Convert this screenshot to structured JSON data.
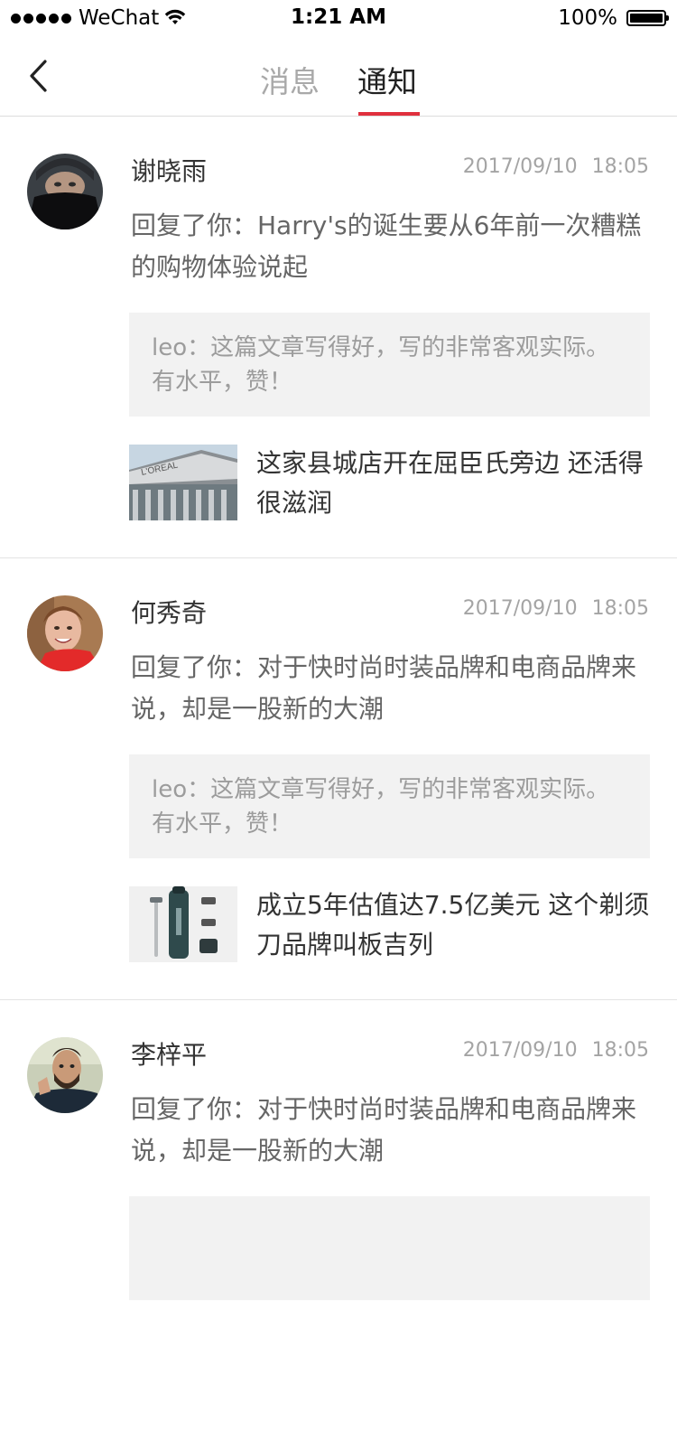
{
  "status_bar": {
    "carrier": "WeChat",
    "time": "1:21 AM",
    "battery": "100%"
  },
  "nav": {
    "tabs": [
      {
        "label": "消息",
        "active": false
      },
      {
        "label": "通知",
        "active": true
      }
    ],
    "accent_color": "#e0303e"
  },
  "notifications": [
    {
      "name": "谢晓雨",
      "date": "2017/09/10",
      "time": "18:05",
      "reply": "回复了你：Harry's的诞生要从6年前一次糟糕的购物体验说起",
      "quote": "leo：这篇文章写得好，写的非常客观实际。有水平，赞！",
      "article_title": "这家县城店开在屈臣氏旁边 还活得很滋润",
      "avatar_icon": "avatar-photo-person-masked",
      "thumbnail_icon": "building-loreal-photo"
    },
    {
      "name": "何秀奇",
      "date": "2017/09/10",
      "time": "18:05",
      "reply": "回复了你：对于快时尚时装品牌和电商品牌来说，却是一股新的大潮",
      "quote": "leo：这篇文章写得好，写的非常客观实际。有水平，赞！",
      "article_title": "成立5年估值达7.5亿美元 这个剃须刀品牌叫板吉列",
      "avatar_icon": "avatar-photo-smiling-woman",
      "thumbnail_icon": "razor-product-photo"
    },
    {
      "name": "李梓平",
      "date": "2017/09/10",
      "time": "18:05",
      "reply": "回复了你：对于快时尚时装品牌和电商品牌来说，却是一股新的大潮",
      "quote": "",
      "article_title": "",
      "avatar_icon": "avatar-photo-man-thumbs-up",
      "thumbnail_icon": ""
    }
  ]
}
